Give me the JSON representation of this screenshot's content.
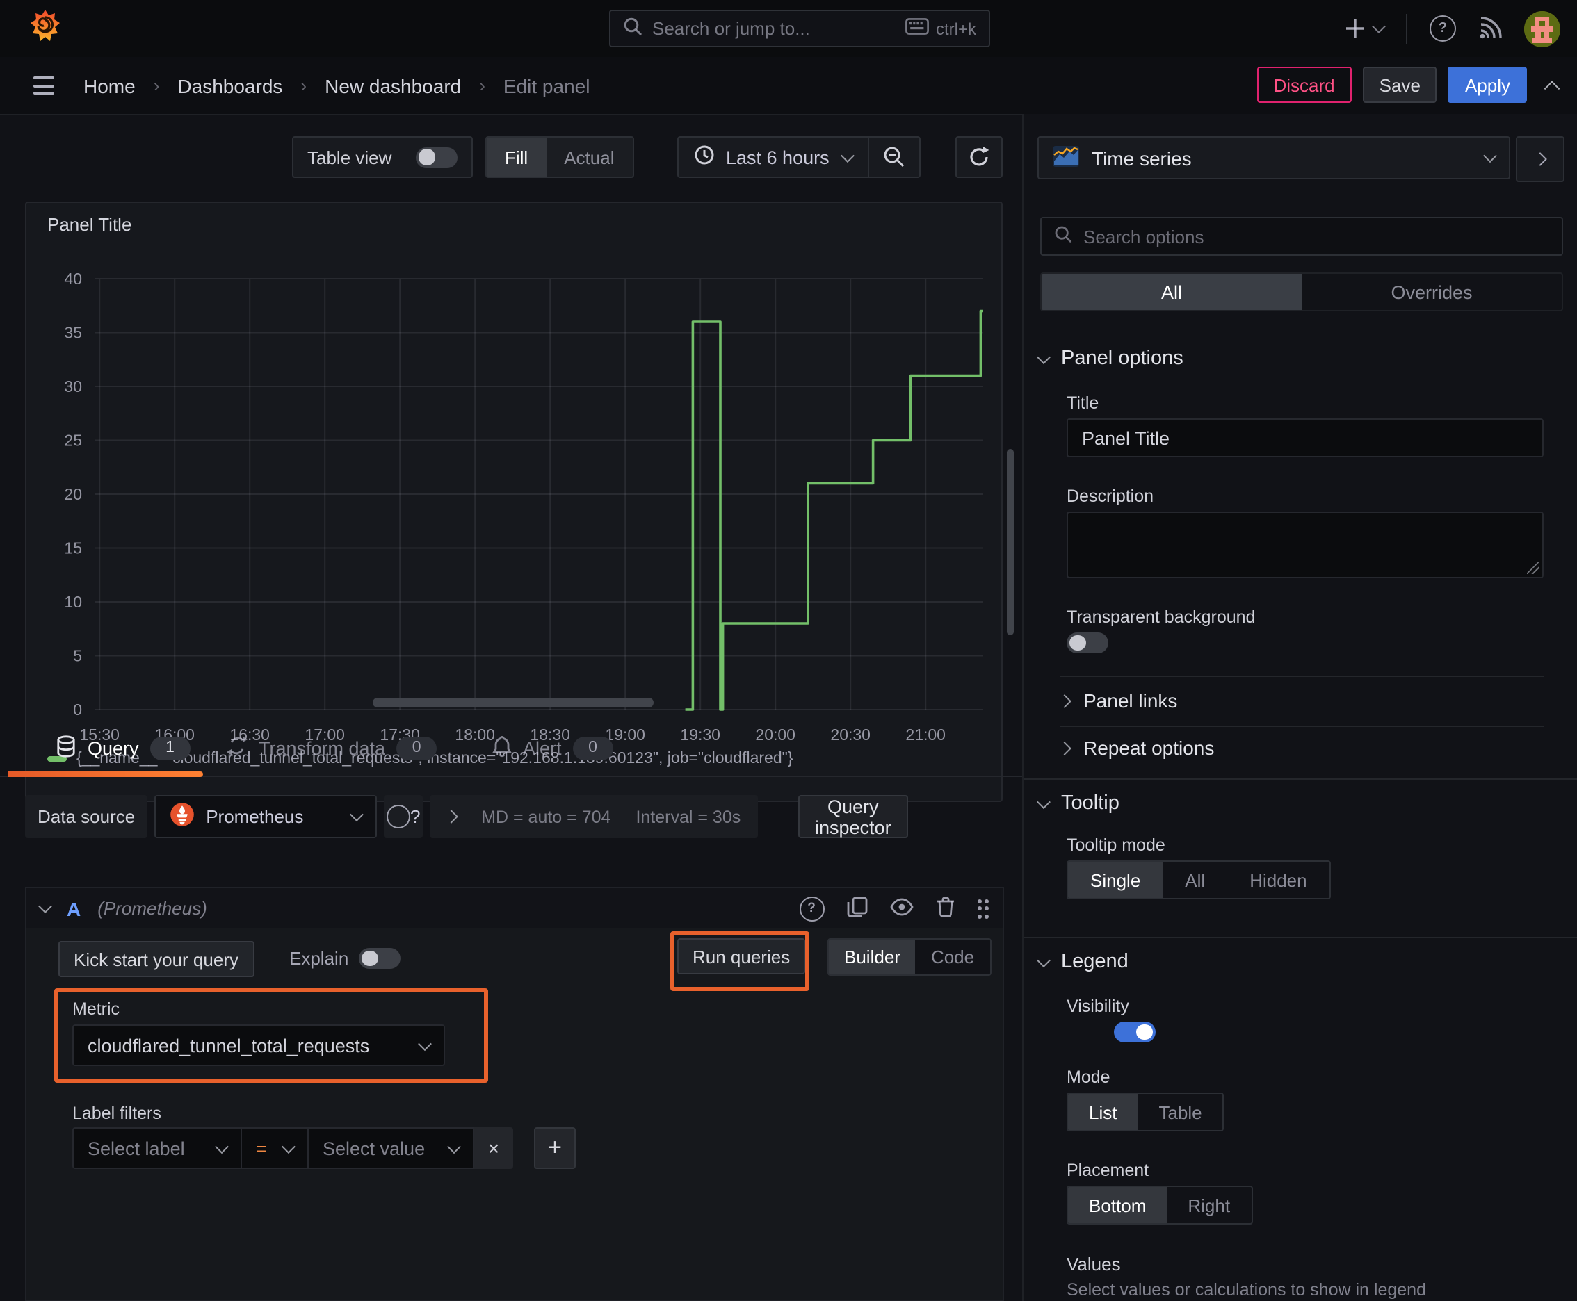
{
  "topbar": {
    "search_placeholder": "Search or jump to...",
    "shortcut": "ctrl+k"
  },
  "breadcrumb": {
    "items": [
      "Home",
      "Dashboards",
      "New dashboard"
    ],
    "current": "Edit panel",
    "discard": "Discard",
    "save": "Save",
    "apply": "Apply"
  },
  "toolbar": {
    "table_view": "Table view",
    "fill": "Fill",
    "actual": "Actual",
    "time_range": "Last 6 hours"
  },
  "viz_picker": {
    "name": "Time series"
  },
  "panel": {
    "title": "Panel Title"
  },
  "chart_data": {
    "type": "line",
    "line_style": "step-after",
    "color": "#73bf69",
    "title": "Panel Title",
    "xlabel": "",
    "ylabel": "",
    "ylim": [
      0,
      40
    ],
    "y_ticks": [
      0,
      5,
      10,
      15,
      20,
      25,
      30,
      35,
      40
    ],
    "x_ticks": [
      "15:30",
      "16:00",
      "16:30",
      "17:00",
      "17:30",
      "18:00",
      "18:30",
      "19:00",
      "19:30",
      "20:00",
      "20:30",
      "21:00"
    ],
    "x_range": [
      "15:28",
      "21:23"
    ],
    "grid": true,
    "legend_position": "bottom",
    "series": [
      {
        "name": "{__name__=\"cloudflared_tunnel_total_requests\", instance=\"192.168.1.189:60123\", job=\"cloudflared\"}",
        "points": [
          [
            "19:24",
            0
          ],
          [
            "19:27",
            36
          ],
          [
            "19:38",
            0
          ],
          [
            "19:39",
            8
          ],
          [
            "20:13",
            21
          ],
          [
            "20:39",
            25
          ],
          [
            "20:54",
            31
          ],
          [
            "21:22",
            37
          ]
        ]
      }
    ]
  },
  "tabs": {
    "query": {
      "label": "Query",
      "count": "1"
    },
    "transform": {
      "label": "Transform data",
      "count": "0"
    },
    "alert": {
      "label": "Alert",
      "count": "0"
    }
  },
  "datasource": {
    "label": "Data source",
    "name": "Prometheus",
    "stat_md": "MD = auto = 704",
    "stat_interval": "Interval = 30s",
    "inspector": "Query inspector"
  },
  "query_row": {
    "letter": "A",
    "ds_hint": "(Prometheus)",
    "kickstart": "Kick start your query",
    "explain": "Explain",
    "run": "Run queries",
    "builder": "Builder",
    "code": "Code",
    "metric_label": "Metric",
    "metric_value": "cloudflared_tunnel_total_requests",
    "label_filters": "Label filters",
    "select_label": "Select label",
    "operator": "=",
    "select_value": "Select value",
    "remove": "×",
    "add": "+"
  },
  "options": {
    "search_placeholder": "Search options",
    "tab_all": "All",
    "tab_overrides": "Overrides",
    "panel_options": {
      "title": "Panel options",
      "title_label": "Title",
      "title_value": "Panel Title",
      "description_label": "Description",
      "transparent_label": "Transparent background"
    },
    "panel_links": "Panel links",
    "repeat_options": "Repeat options",
    "tooltip": {
      "title": "Tooltip",
      "mode_label": "Tooltip mode",
      "modes": [
        "Single",
        "All",
        "Hidden"
      ],
      "selected": "Single"
    },
    "legend": {
      "title": "Legend",
      "visibility_label": "Visibility",
      "mode_label": "Mode",
      "modes": [
        "List",
        "Table"
      ],
      "selected_mode": "List",
      "placement_label": "Placement",
      "placements": [
        "Bottom",
        "Right"
      ],
      "selected_placement": "Bottom",
      "values_label": "Values",
      "values_desc": "Select values or calculations to show in legend"
    }
  },
  "colors": {
    "accent_blue": "#3d71d9",
    "accent_orange": "#e8612c",
    "destructive": "#e0226e",
    "series_green": "#73bf69",
    "prometheus_orange": "#e6522c"
  }
}
